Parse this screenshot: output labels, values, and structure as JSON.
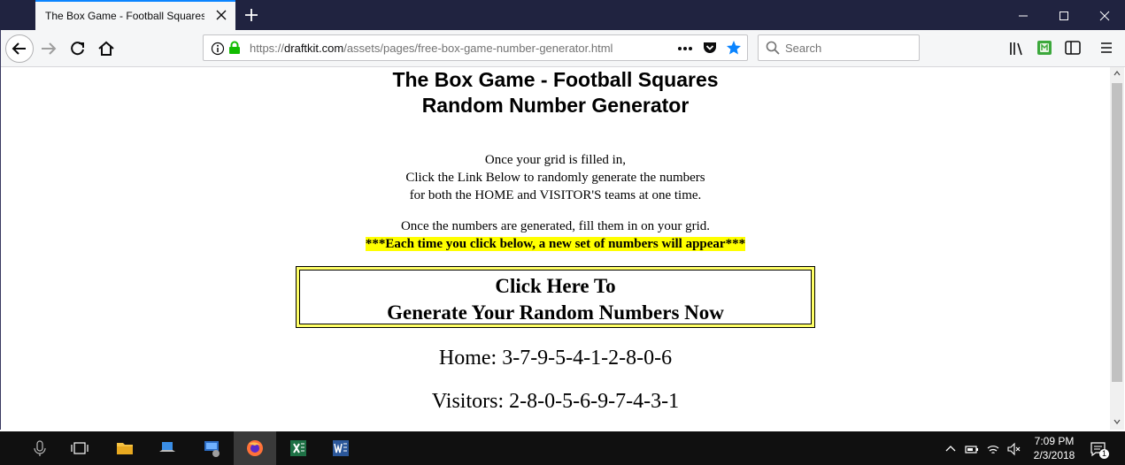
{
  "browser": {
    "tab_title": "The Box Game - Football Squares -",
    "url_prefix": "https://",
    "url_domain": "draftkit.com",
    "url_path": "/assets/pages/free-box-game-number-generator.html",
    "search_placeholder": "Search"
  },
  "page": {
    "title_line1": "The Box Game - Football Squares",
    "title_line2": "Random Number Generator",
    "instr_line1": "Once your grid is filled in,",
    "instr_line2": "Click the Link Below to randomly generate the numbers",
    "instr_line3": "for both the HOME and VISITOR'S teams at one time.",
    "instr_line4": "Once the numbers are generated, fill them in on your grid.",
    "highlight_text": "***Each time you click below, a new set of numbers will appear***",
    "generate_line1": "Click Here To",
    "generate_line2": "Generate Your Random Numbers Now",
    "home_result": "Home: 3-7-9-5-4-1-2-8-0-6",
    "visitors_result": "Visitors: 2-8-0-5-6-9-7-4-3-1"
  },
  "taskbar": {
    "time": "7:09 PM",
    "date": "2/3/2018",
    "notification_count": "1"
  }
}
